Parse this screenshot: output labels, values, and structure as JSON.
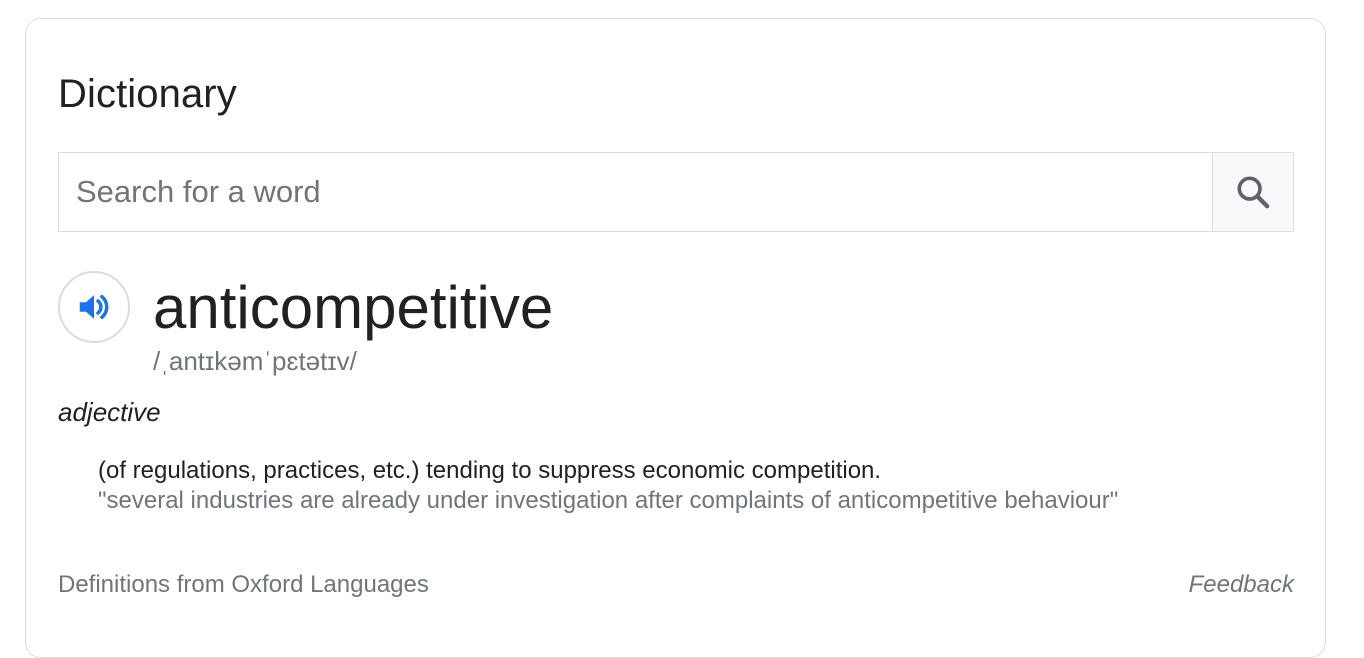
{
  "card": {
    "title": "Dictionary"
  },
  "search": {
    "placeholder": "Search for a word",
    "value": "",
    "button_icon": "search-icon"
  },
  "entry": {
    "speaker_icon": "speaker-icon",
    "word": "anticompetitive",
    "phonetic": "/ˌantɪkəmˈpɛtətɪv/",
    "part_of_speech": "adjective",
    "definition": "(of regulations, practices, etc.) tending to suppress economic competition.",
    "example": "\"several industries are already under investigation after complaints of anticompetitive behaviour\""
  },
  "footer": {
    "source": "Definitions from Oxford Languages",
    "feedback": "Feedback"
  },
  "colors": {
    "accent": "#1a73e8",
    "text": "#202124",
    "secondary_text": "#70757a",
    "border": "#dadce0"
  }
}
